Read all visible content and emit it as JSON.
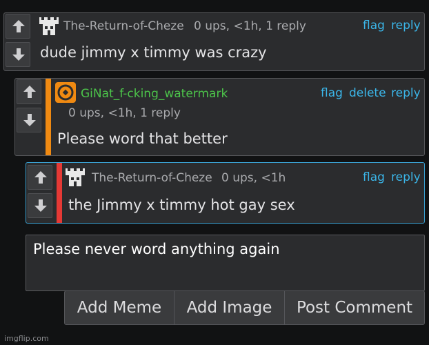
{
  "comments": [
    {
      "username": "The-Return-of-Cheze",
      "meta": "0 ups, <1h, 1 reply",
      "text": "dude jimmy x timmy was crazy",
      "actions": [
        "flag",
        "reply"
      ],
      "avatar": "castle-avatar-icon"
    },
    {
      "username": "GiNat_f-cking_watermark",
      "meta": "0 ups, <1h, 1 reply",
      "text": "Please word that better",
      "actions": [
        "flag",
        "delete",
        "reply"
      ],
      "avatar": "orange-target-avatar-icon",
      "accent_color": "#f08a12",
      "username_color": "#4cc44a"
    },
    {
      "username": "The-Return-of-Cheze",
      "meta": "0 ups, <1h",
      "text": "the Jimmy x timmy hot gay sex",
      "actions": [
        "flag",
        "reply"
      ],
      "avatar": "castle-avatar-icon",
      "accent_color": "#e53935"
    }
  ],
  "reply_box": {
    "value": "Please never word anything again"
  },
  "buttons": {
    "add_meme": "Add Meme",
    "add_image": "Add Image",
    "post_comment": "Post Comment"
  },
  "watermark": "imgflip.com",
  "colors": {
    "link": "#3bb6e9",
    "background": "#111213",
    "panel": "#2b2c2e"
  }
}
